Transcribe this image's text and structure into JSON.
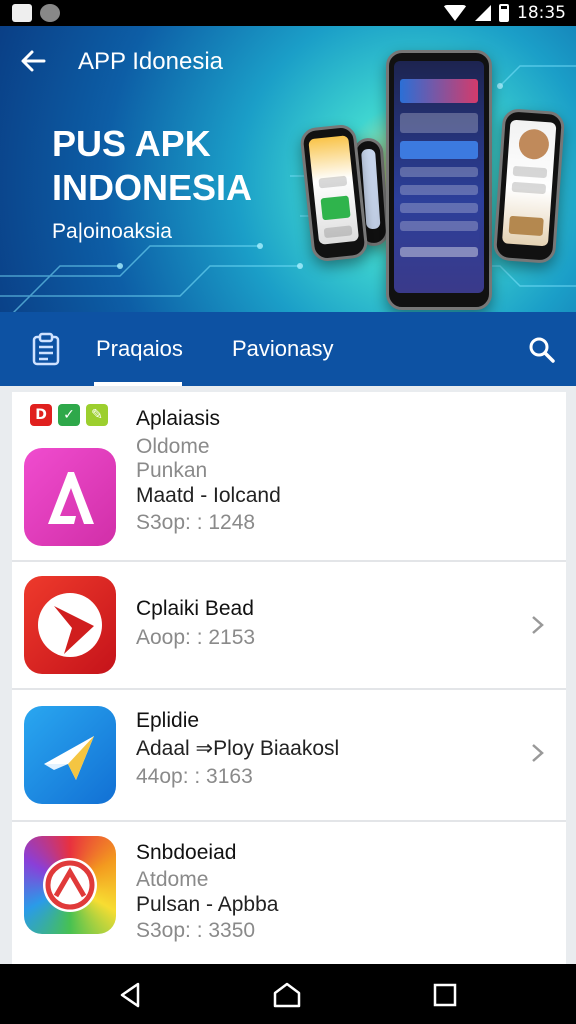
{
  "status_bar": {
    "time": "18:35"
  },
  "header": {
    "back_icon": "arrow-left-icon",
    "title": "APP Idonesia"
  },
  "banner": {
    "hero_title": "PUS APK INDONESIA",
    "hero_subtitle": "Pa|oinoaksia"
  },
  "tabs": [
    {
      "label": "Praqaios",
      "active": true
    },
    {
      "label": "Pavionasy",
      "active": false
    }
  ],
  "list": [
    {
      "title": "Aplaiasis",
      "line1": "Oldome",
      "line2": "Punkan",
      "line3": "Maatd  - Iolcand",
      "line4": "S3op: : 1248",
      "icon": "a-letter-icon"
    },
    {
      "title": "Cplaiki Bead",
      "line1": "Aoop: : 2153",
      "icon": "play-arrow-icon"
    },
    {
      "title": "Eplidie",
      "line1": "Adaal ⇒Ploy Biaakosl",
      "line2": "44op: : 3163",
      "icon": "paper-plane-icon"
    },
    {
      "title": "Snbdoeiad",
      "line1": "Atdome",
      "line2": "Pulsan  - Apbba",
      "line3": "S3op: : 3350",
      "icon": "circle-arrow-icon"
    }
  ],
  "colors": {
    "accent": "#0d52a3",
    "icon1": "#e83bbd",
    "icon2": "#e0201e",
    "icon3": "#1c8fe4"
  }
}
